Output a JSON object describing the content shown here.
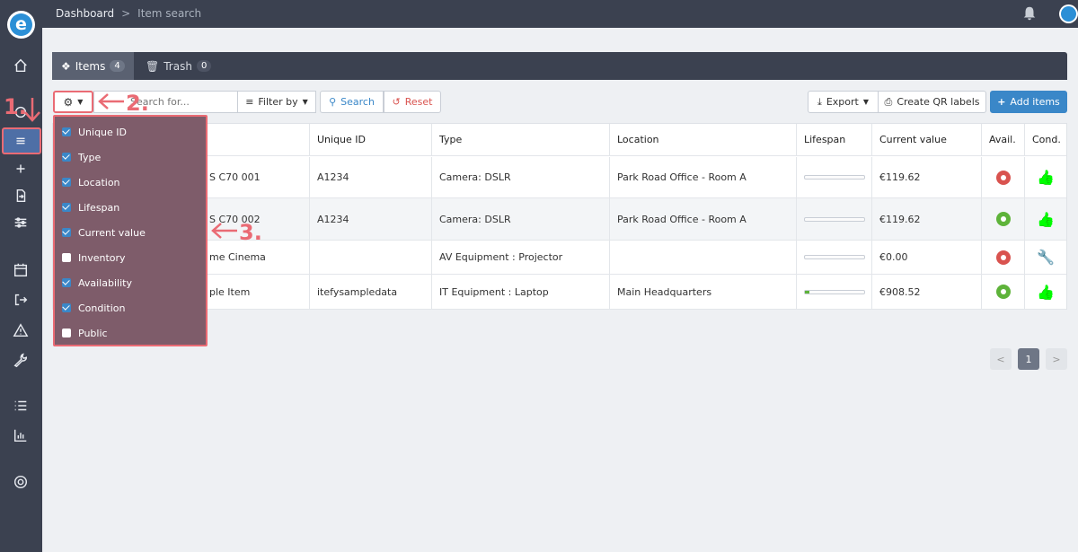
{
  "app": {
    "logo_letter": "e"
  },
  "breadcrumb": {
    "root": "Dashboard",
    "separator": ">",
    "current": "Item search"
  },
  "tabs": [
    {
      "label": "Items",
      "count": "4",
      "icon": "cubes-icon"
    },
    {
      "label": "Trash",
      "count": "0",
      "icon": "trash-icon"
    }
  ],
  "toolbar": {
    "search_placeholder": "Search for...",
    "filter_label": "Filter by",
    "search_label": "Search",
    "reset_label": "Reset",
    "export_label": "Export",
    "qr_label": "Create QR labels",
    "add_label": "Add items"
  },
  "table": {
    "headers": [
      "",
      "Unique ID",
      "Type",
      "Location",
      "Lifespan",
      "Current value",
      "Avail.",
      "Cond."
    ],
    "rows": [
      {
        "name": "S C70 001",
        "uid": "A1234",
        "type": "Camera: DSLR",
        "location": "Park Road Office - Room A",
        "lifespan": 0,
        "value": "€119.62",
        "avail": "unavailable",
        "cond": "good"
      },
      {
        "name": "S C70 002",
        "uid": "A1234",
        "type": "Camera: DSLR",
        "location": "Park Road Office - Room A",
        "lifespan": 0,
        "value": "€119.62",
        "avail": "available",
        "cond": "good"
      },
      {
        "name": "me Cinema",
        "uid": "",
        "type": "AV Equipment : Projector",
        "location": "",
        "lifespan": 0,
        "value": "€0.00",
        "avail": "unavailable",
        "cond": "repair"
      },
      {
        "name": "ple Item",
        "uid": "itefysampledata",
        "type": "IT Equipment : Laptop",
        "location": "Main Headquarters",
        "lifespan": 0.08,
        "value": "€908.52",
        "avail": "available",
        "cond": "good"
      }
    ]
  },
  "column_menu": [
    {
      "label": "Unique ID",
      "checked": true
    },
    {
      "label": "Type",
      "checked": true
    },
    {
      "label": "Location",
      "checked": true
    },
    {
      "label": "Lifespan",
      "checked": true
    },
    {
      "label": "Current value",
      "checked": true
    },
    {
      "label": "Inventory",
      "checked": false
    },
    {
      "label": "Availability",
      "checked": true
    },
    {
      "label": "Condition",
      "checked": true
    },
    {
      "label": "Public",
      "checked": false
    }
  ],
  "annotations": {
    "step1": "1.",
    "step2": "2.",
    "step3": "3."
  },
  "pagination": {
    "prev": "<",
    "current": "1",
    "next": ">"
  },
  "colors": {
    "accent": "#3a87c8",
    "danger": "#d9534f",
    "success": "#5eb33a",
    "sidebar": "#3b4150",
    "highlight": "#ea6b74",
    "menu_bg": "#7e5c6a",
    "wrench": "#e07a3f"
  }
}
